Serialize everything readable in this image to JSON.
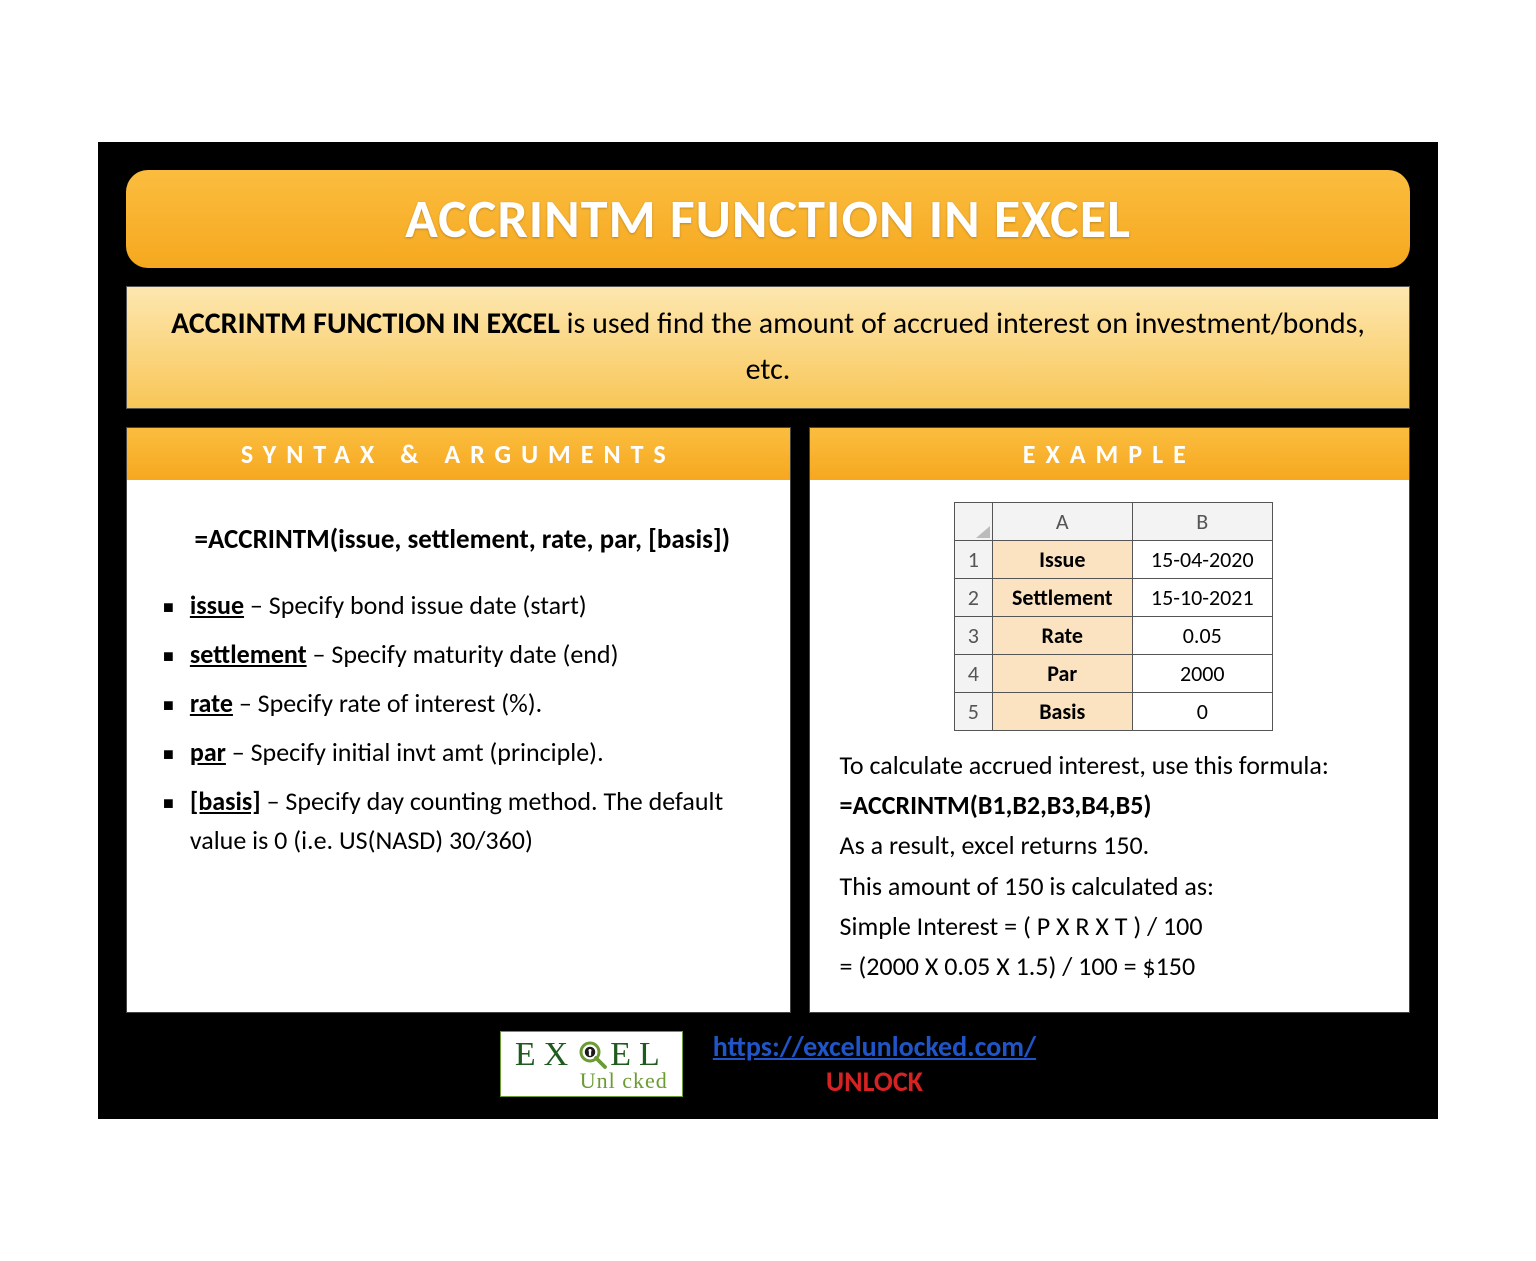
{
  "title": "ACCRINTM FUNCTION IN EXCEL",
  "description": {
    "bold": "ACCRINTM FUNCTION IN EXCEL",
    "rest": " is used find the amount of accrued interest on investment/bonds, etc."
  },
  "syntax": {
    "header": "SYNTAX & ARGUMENTS",
    "formula": "=ACCRINTM(issue, settlement, rate, par, [basis])",
    "args": [
      {
        "name": "issue",
        "text": " – Specify bond issue date (start)"
      },
      {
        "name": "settlement",
        "text": " – Specify maturity date (end)"
      },
      {
        "name": "rate",
        "text": " – Specify rate of interest (%)."
      },
      {
        "name": "par",
        "text": " – Specify initial invt amt (principle)."
      },
      {
        "name": "[basis]",
        "text": " – Specify day counting method. The default value is 0 (i.e. US(NASD) 30/360)"
      }
    ]
  },
  "example": {
    "header": "EXAMPLE",
    "table": {
      "col_a": "A",
      "col_b": "B",
      "rows": [
        {
          "n": "1",
          "label": "Issue",
          "value": "15-04-2020"
        },
        {
          "n": "2",
          "label": "Settlement",
          "value": "15-10-2021"
        },
        {
          "n": "3",
          "label": "Rate",
          "value": "0.05"
        },
        {
          "n": "4",
          "label": "Par",
          "value": "2000"
        },
        {
          "n": "5",
          "label": "Basis",
          "value": "0"
        }
      ]
    },
    "intro": "To calculate accrued interest, use this formula:",
    "formula": "=ACCRINTM(B1,B2,B3,B4,B5)",
    "result_line": "As a result, excel returns 150.",
    "calc_intro": "This amount of 150 is calculated as:",
    "simple_interest": "Simple Interest = ( P X R X T ) / 100",
    "calc": "= (2000 X 0.05 X 1.5) / 100 = $150"
  },
  "footer": {
    "logo_top_left": "EX",
    "logo_top_right": "EL",
    "logo_bottom": "Unl   cked",
    "url": "https://excelunlocked.com/",
    "unlock": "UNLOCK"
  }
}
